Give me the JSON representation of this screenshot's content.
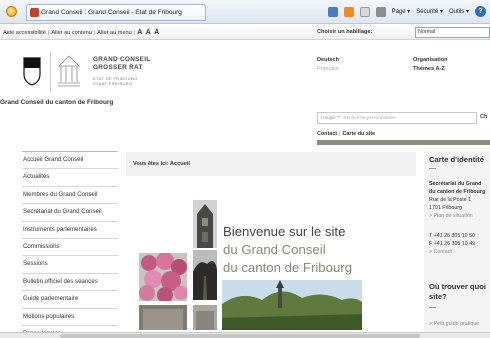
{
  "browser": {
    "tab_title": "Grand Conseil : Grand Conseil - Etat de Fribourg",
    "menu_page": "Page ▾",
    "menu_security": "Sécurité ▾",
    "menu_tools": "Outils ▾",
    "help": "?"
  },
  "accessibility": {
    "aid": "Aide accessibilité",
    "to_content": "Aller au contenu",
    "to_menu": "Aller au menu",
    "font_sizes": "A A A",
    "skin_label": "Choisir un habillage:",
    "skin_value": "Normal"
  },
  "header": {
    "logo_line1": "GRAND CONSEIL",
    "logo_line2": "GROSSER RAT",
    "logo_sub1": "ETAT DE FRIBOURG",
    "logo_sub2": "STAAT FREIBURG",
    "site_name": "Grand Conseil du canton de Fribourg",
    "lang_de": "Deutsch",
    "lang_fr": "Français",
    "org_title": "Organisation",
    "org_az": "Thèmes A-Z",
    "search_brand": "Google™",
    "search_placeholder": "Recherche personnalisée",
    "search_button": "Ch",
    "contact": "Contact",
    "sitemap": "Carte du site"
  },
  "menu": [
    "Accueil Grand Conseil",
    "Actualités",
    "Membres du Grand Conseil",
    "Secrétariat du Grand Conseil",
    "Instruments parlementaires",
    "Commissions",
    "Sessions",
    "Bulletin officiel des séances",
    "Guide parlementaire",
    "Motions populaires",
    "Bases légales"
  ],
  "main": {
    "breadcrumb": "Vous êtes ici: Accueil",
    "welcome_line1": "Bienvenue sur le site",
    "welcome_line2": "du Grand Conseil",
    "welcome_line3": "du canton de Fribourg"
  },
  "sidebar": {
    "identity_title": "Carte d'identité",
    "identity_dash": "—",
    "org_line1": "Secrétariat du Grand",
    "org_line2": "du canton de Fribourg",
    "address1": "Rue de la Poste 1",
    "address2": "1701 Fribourg",
    "location_link": "> Plan de situation",
    "phone": "T +41 26 305 10 50",
    "fax": "F +41 26 305 10 49",
    "contact_link": "> Contact",
    "where_title1": "Où trouver quoi",
    "where_title2": "site?",
    "where_dash": "—",
    "guide_link": "> Petit guide pratique"
  },
  "colors": {
    "accent_rule": "#8f8b80",
    "welcome_grey": "#8c867a",
    "side_column_bg": "#f4f4f4"
  },
  "icons": [
    "favorites-star-icon",
    "home-icon",
    "rss-icon",
    "mail-icon",
    "print-icon",
    "help-icon",
    "canton-shield-logo",
    "parliament-building-logo"
  ]
}
